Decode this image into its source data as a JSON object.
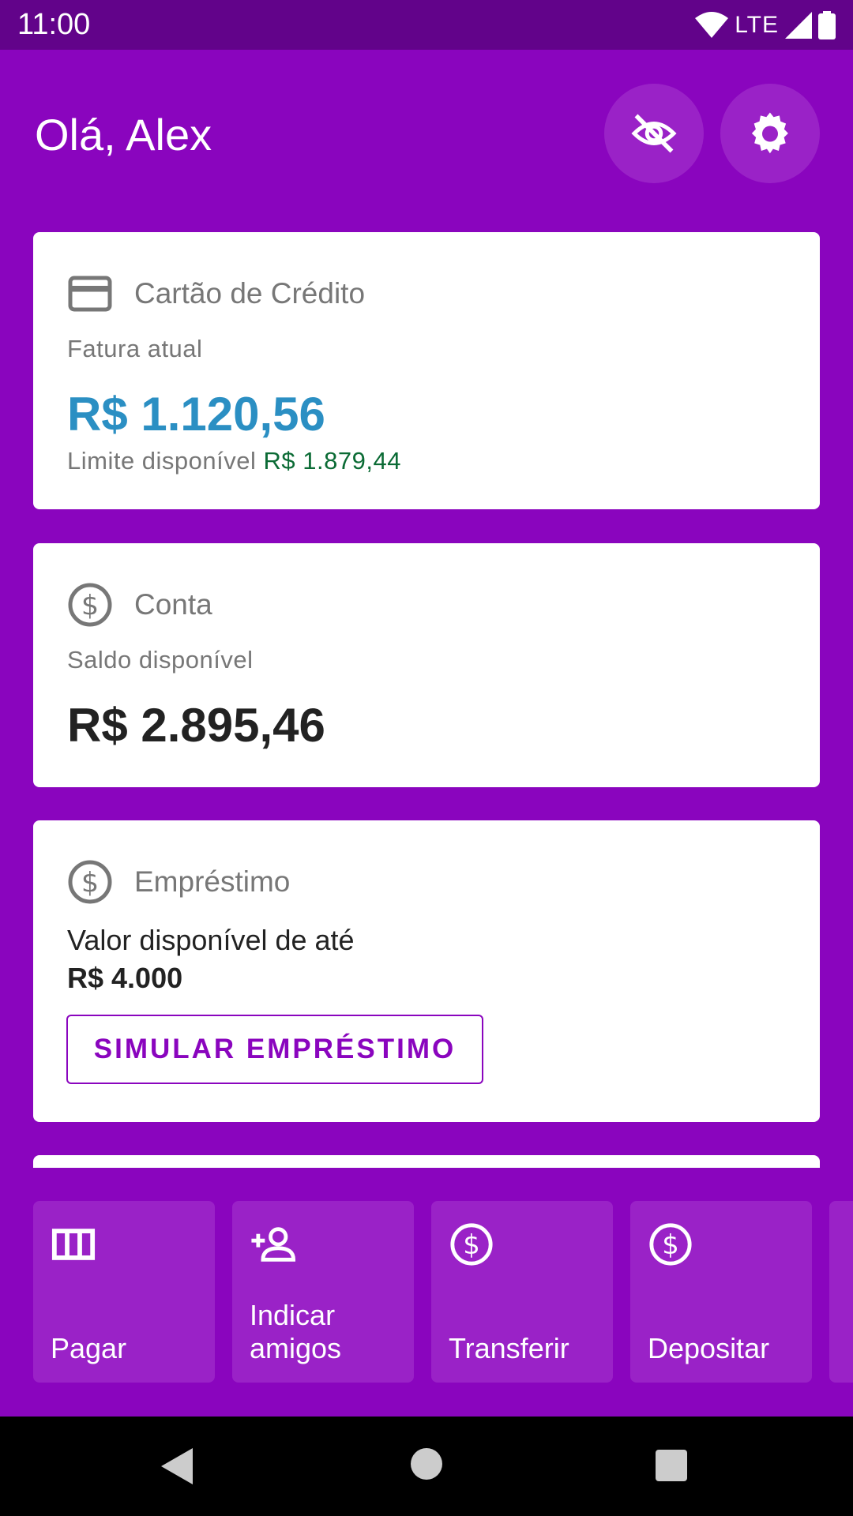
{
  "status_bar": {
    "time": "11:00",
    "network": "LTE"
  },
  "header": {
    "greeting": "Olá, Alex"
  },
  "credit_card": {
    "title": "Cartão de Crédito",
    "subtitle": "Fatura atual",
    "amount": "R$ 1.120,56",
    "limit_label": "Limite disponível",
    "limit_value": "R$ 1.879,44",
    "amount_color": "#2b8fc3"
  },
  "account": {
    "title": "Conta",
    "subtitle": "Saldo disponível",
    "balance": "R$ 2.895,46"
  },
  "loan": {
    "title": "Empréstimo",
    "text": "Valor disponível de até",
    "value": "R$ 4.000",
    "button_label": "SIMULAR EMPRÉSTIMO"
  },
  "actions": [
    {
      "label": "Pagar",
      "icon": "barcode-icon"
    },
    {
      "label": "Indicar amigos",
      "icon": "add-person-icon"
    },
    {
      "label": "Transferir",
      "icon": "dollar-circle-icon"
    },
    {
      "label": "Depositar",
      "icon": "dollar-circle-icon"
    }
  ],
  "colors": {
    "brand": "#8a05be",
    "status_bar": "#62038a",
    "limit_green": "#0b6b35"
  }
}
